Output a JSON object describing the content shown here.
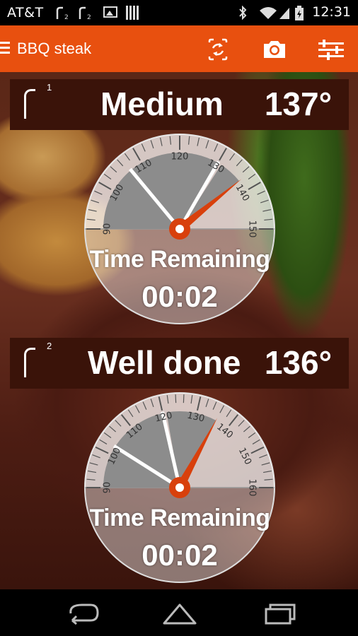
{
  "status_bar": {
    "carrier": "AT&T",
    "signal_1": "r",
    "signal_2": "r",
    "time": "12:31"
  },
  "toolbar": {
    "title": "BBQ steak",
    "icons": [
      "menu-icon",
      "switch-camera-icon",
      "camera-icon",
      "settings-sliders-icon"
    ]
  },
  "colors": {
    "accent": "#e8500f",
    "bar": "#3a1309",
    "needle": "#d8400c"
  },
  "probes": [
    {
      "number": "1",
      "doneness": "Medium",
      "temperature": "137°",
      "time_label": "Time Remaining",
      "time_value": "00:02",
      "scale_min": 90,
      "scale_max": 150,
      "ticks": [
        "90",
        "100",
        "110",
        "120",
        "130",
        "140",
        "150"
      ],
      "target": 130,
      "current": 137
    },
    {
      "number": "2",
      "doneness": "Well done",
      "temperature": "136°",
      "time_label": "Time Remaining",
      "time_value": "00:02",
      "scale_min": 90,
      "scale_max": 160,
      "ticks": [
        "90",
        "100",
        "110",
        "120",
        "130",
        "140",
        "150",
        "160"
      ],
      "target": 120,
      "current": 136
    }
  ],
  "nav": {
    "icons": [
      "back-icon",
      "home-icon",
      "recents-icon"
    ]
  }
}
